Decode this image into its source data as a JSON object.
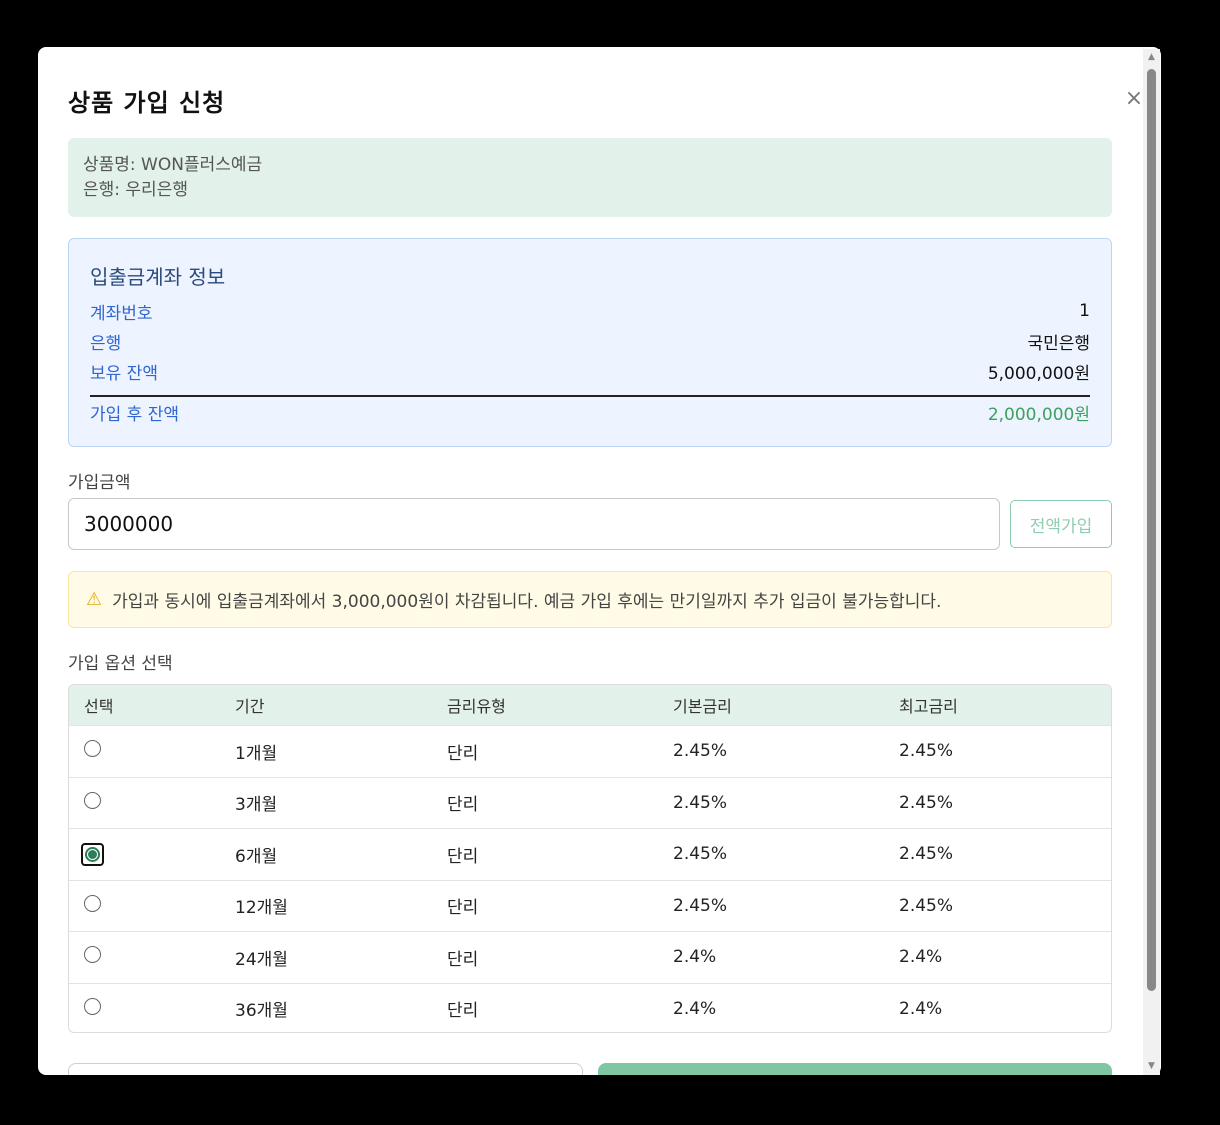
{
  "modal": {
    "title": "상품 가입 신청",
    "close_icon": "×"
  },
  "product": {
    "name_line": "상품명: WON플러스예금",
    "bank_line": "은행: 우리은행"
  },
  "account": {
    "title": "입출금계좌 정보",
    "rows": [
      {
        "label": "계좌번호",
        "value": "1"
      },
      {
        "label": "은행",
        "value": "국민은행"
      },
      {
        "label": "보유 잔액",
        "value": "5,000,000원"
      }
    ],
    "after": {
      "label": "가입 후 잔액",
      "value": "2,000,000원"
    }
  },
  "amount": {
    "label": "가입금액",
    "value": "3000000",
    "full_button": "전액가입"
  },
  "warning": {
    "icon": "⚠",
    "text": "가입과 동시에 입출금계좌에서 3,000,000원이 차감됩니다. 예금 가입 후에는 만기일까지 추가 입금이 불가능합니다."
  },
  "options": {
    "label": "가입 옵션 선택",
    "headers": [
      "선택",
      "기간",
      "금리유형",
      "기본금리",
      "최고금리"
    ],
    "rows": [
      {
        "period": "1개월",
        "type": "단리",
        "base": "2.45%",
        "max": "2.45%",
        "selected": false
      },
      {
        "period": "3개월",
        "type": "단리",
        "base": "2.45%",
        "max": "2.45%",
        "selected": false
      },
      {
        "period": "6개월",
        "type": "단리",
        "base": "2.45%",
        "max": "2.45%",
        "selected": true
      },
      {
        "period": "12개월",
        "type": "단리",
        "base": "2.45%",
        "max": "2.45%",
        "selected": false
      },
      {
        "period": "24개월",
        "type": "단리",
        "base": "2.4%",
        "max": "2.4%",
        "selected": false
      },
      {
        "period": "36개월",
        "type": "단리",
        "base": "2.4%",
        "max": "2.4%",
        "selected": false
      }
    ]
  },
  "colors": {
    "accent_green": "#7fc6a2",
    "balance_green": "#3ea05e",
    "label_blue": "#2f66d0"
  }
}
